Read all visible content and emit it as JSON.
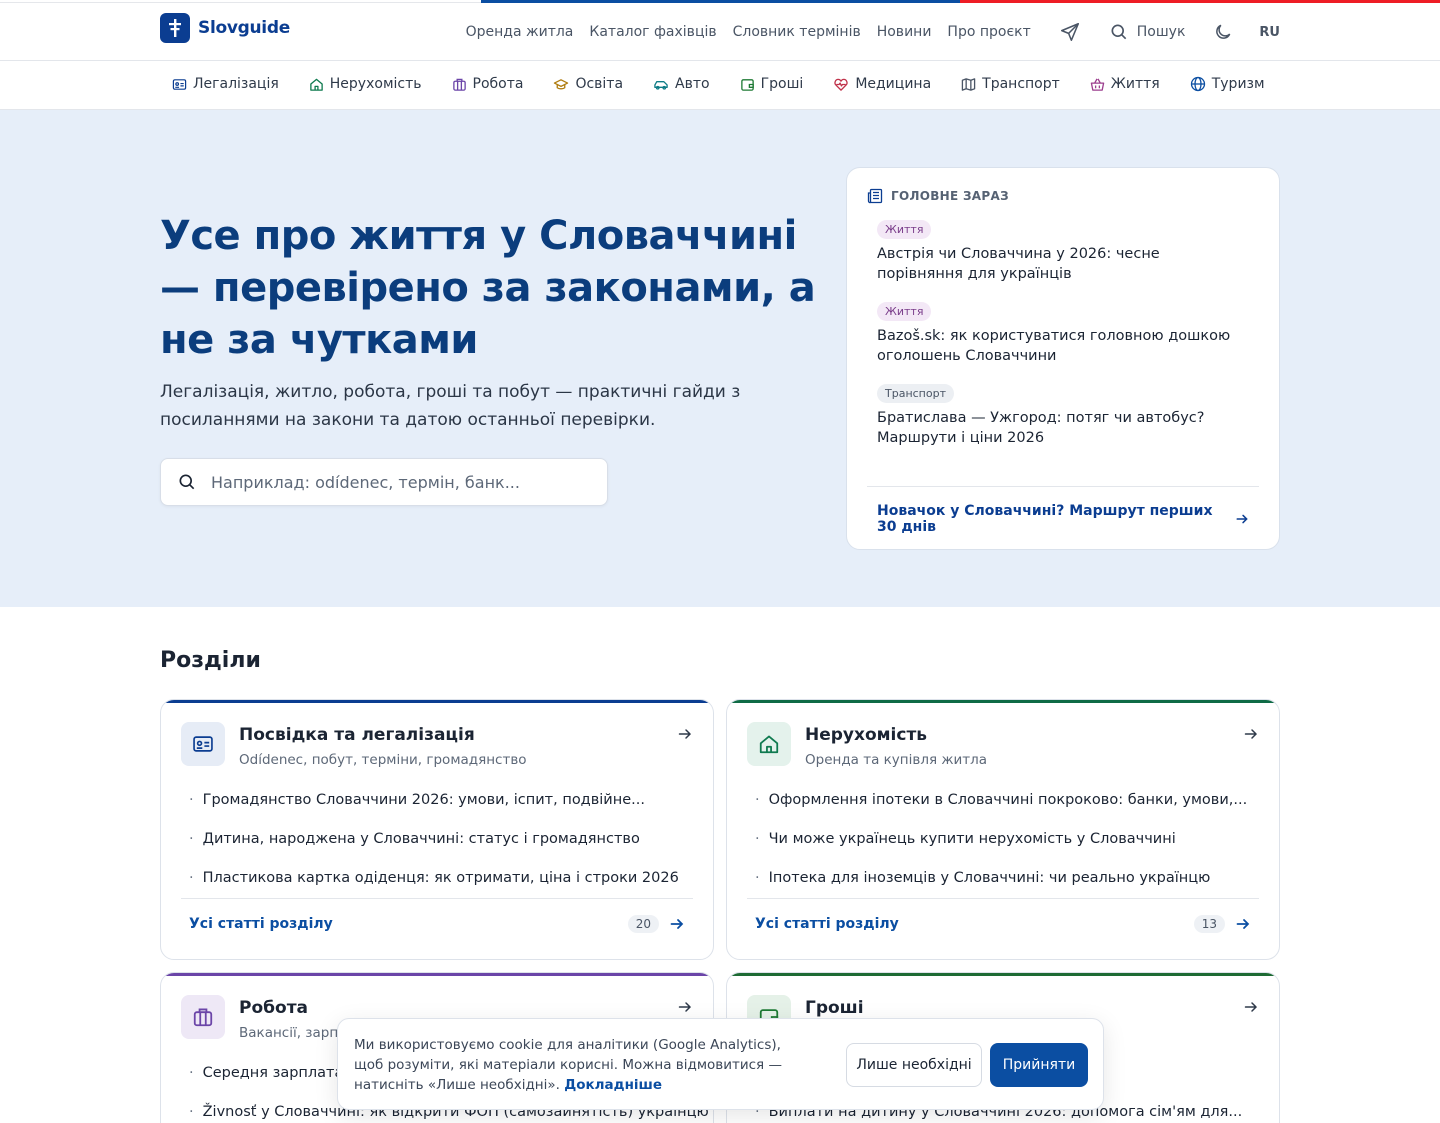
{
  "brand": {
    "name": "Slovguide"
  },
  "topnav": {
    "links": [
      "Оренда житла",
      "Каталог фахівців",
      "Словник термінів",
      "Новини",
      "Про проєкт"
    ],
    "search_label": "Пошук",
    "lang": "RU"
  },
  "categories": [
    {
      "label": "Легалізація",
      "icon": "id-card-icon",
      "color": "#0b3d91"
    },
    {
      "label": "Нерухомість",
      "icon": "home-icon",
      "color": "#0f7a4f"
    },
    {
      "label": "Робота",
      "icon": "briefcase-icon",
      "color": "#6b45a8"
    },
    {
      "label": "Освіта",
      "icon": "graduation-cap-icon",
      "color": "#b07d10"
    },
    {
      "label": "Авто",
      "icon": "car-icon",
      "color": "#0e7c86"
    },
    {
      "label": "Гроші",
      "icon": "wallet-icon",
      "color": "#1e7a34"
    },
    {
      "label": "Медицина",
      "icon": "heart-pulse-icon",
      "color": "#c0324a"
    },
    {
      "label": "Транспорт",
      "icon": "map-icon",
      "color": "#4a5565"
    },
    {
      "label": "Життя",
      "icon": "basket-icon",
      "color": "#9c3e8e"
    },
    {
      "label": "Туризм",
      "icon": "globe-icon",
      "color": "#0b4ea2"
    }
  ],
  "hero": {
    "title": "Усе про життя у Словаччині — перевірено за законами, а не за чутками",
    "subtitle": "Легалізація, житло, робота, гроші та побут — практичні гайди з посиланнями на закони та датою останньої перевірки.",
    "search_placeholder": "Наприклад: odídenec, термін, банк..."
  },
  "headline_card": {
    "heading": "ГОЛОВНЕ ЗАРАЗ",
    "items": [
      {
        "tag": "Життя",
        "title": "Австрія чи Словаччина у 2026: чесне порівняння для українців"
      },
      {
        "tag": "Життя",
        "title": "Bazoš.sk: як користуватися головною дошкою оголошень Словаччини"
      },
      {
        "tag": "Транспорт",
        "title": "Братислава — Ужгород: потяг чи автобус? Маршрути і ціни 2026"
      }
    ],
    "footer_link": "Новачок у Словаччині? Маршрут перших 30 днів"
  },
  "sections": {
    "heading": "Розділи",
    "items": [
      {
        "title": "Посвідка та легалізація",
        "desc": "Odídenec, побут, терміни, громадянство",
        "accent": "#0b3d91",
        "icon": "id-card-icon",
        "articles": [
          "Громадянство Словаччини 2026: умови, іспит, подвійне...",
          "Дитина, народжена у Словаччині: статус і громадянство",
          "Пластикова картка одіденця: як отримати, ціна і строки 2026"
        ],
        "all_label": "Усі статті розділу",
        "count": "20"
      },
      {
        "title": "Нерухомість",
        "desc": "Оренда та купівля житла",
        "accent": "#0f6b46",
        "icon": "home-icon",
        "articles": [
          "Оформлення іпотеки в Словаччині покроково: банки, умови,...",
          "Чи може українець купити нерухомість у Словаччині",
          "Іпотека для іноземців у Словаччині: чи реально українцю"
        ],
        "all_label": "Усі статті розділу",
        "count": "13"
      },
      {
        "title": "Робота",
        "desc": "Вакансії, зарпл",
        "accent": "#6b45a8",
        "icon": "briefcase-icon",
        "articles": [
          "Середня зарплата",
          "Živnosť у Словаччині: як відкрити ФОП (самозайнятість) українцю"
        ]
      },
      {
        "title": "Гроші",
        "desc": "",
        "accent": "#1e6b34",
        "icon": "wallet-icon",
        "articles": [
          "",
          "Виплати на дитину у Словаччині 2026: допомога сім'ям для..."
        ]
      }
    ]
  },
  "cookie": {
    "text": "Ми використовуємо cookie для аналітики (Google Analytics), щоб розуміти, які матеріали корисні. Можна відмовитися — натисніть «Лише необхідні».",
    "more_link": "Докладніше",
    "necessary_label": "Лише необхідні",
    "accept_label": "Прийняти"
  }
}
